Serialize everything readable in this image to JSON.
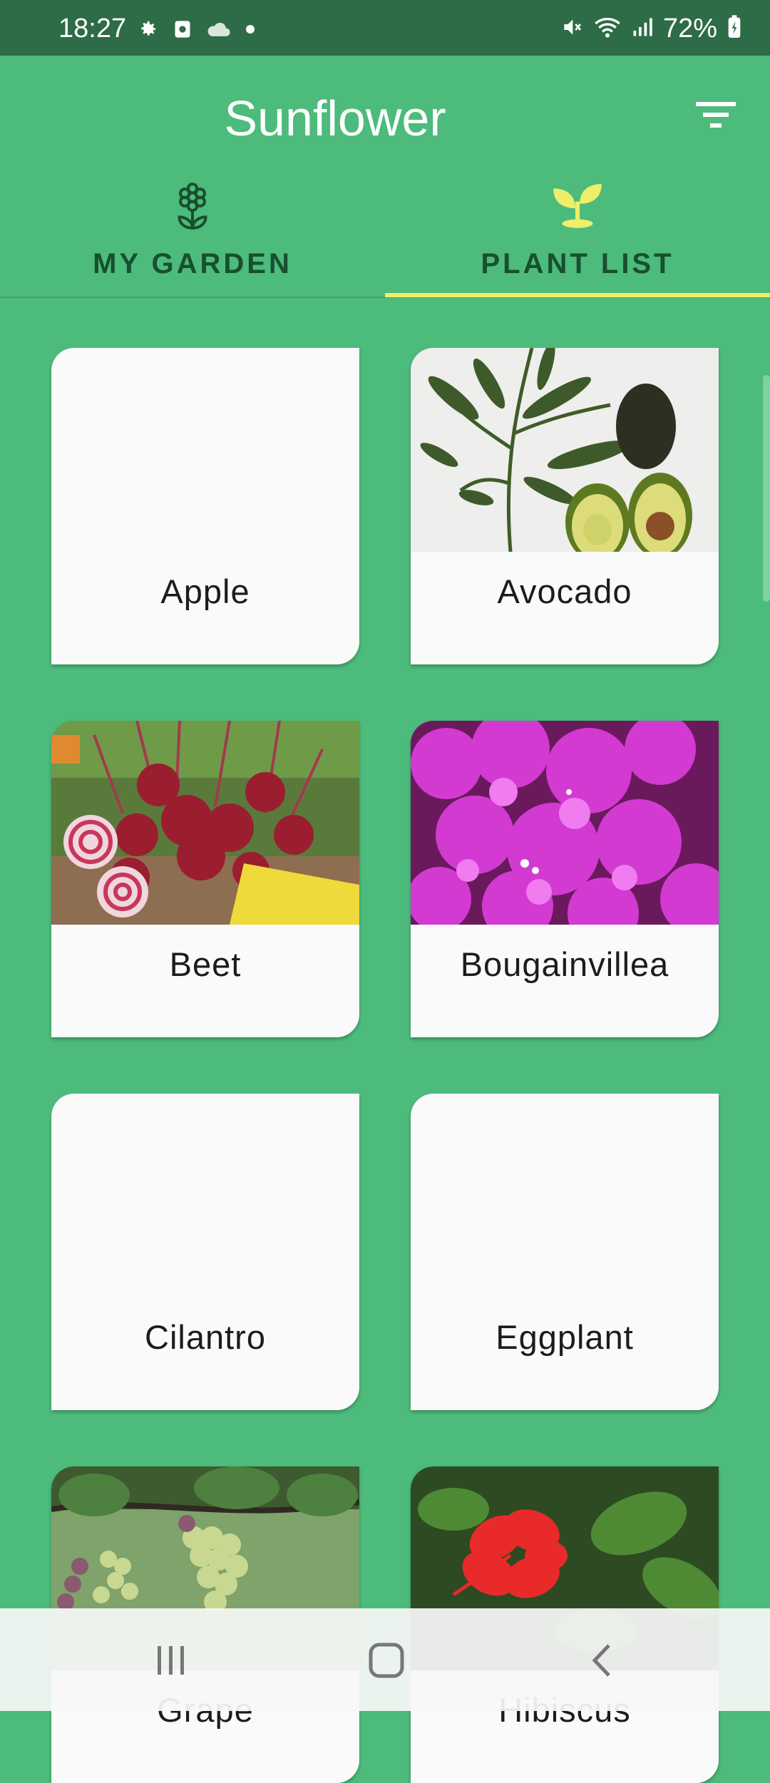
{
  "status_bar": {
    "time": "18:27",
    "battery": "72%",
    "left_icons": [
      "settings-icon",
      "screen-record-icon",
      "cloud-icon",
      "dot-icon"
    ],
    "right_icons": [
      "mute-icon",
      "wifi-icon",
      "signal-icon",
      "battery-icon"
    ]
  },
  "app_bar": {
    "title": "Sunflower",
    "filter_icon": "filter-list-icon"
  },
  "tabs": [
    {
      "label": "MY GARDEN",
      "icon": "flower-icon",
      "selected": false
    },
    {
      "label": "PLANT LIST",
      "icon": "sprout-icon",
      "selected": true
    }
  ],
  "colors": {
    "primary": "#4cbb7b",
    "status_bar": "#2e6b47",
    "tab_indicator": "#efee6a",
    "tab_text": "#184f2e",
    "card": "#fafafa"
  },
  "plants": [
    {
      "name": "Apple",
      "has_image": false
    },
    {
      "name": "Avocado",
      "has_image": true
    },
    {
      "name": "Beet",
      "has_image": true
    },
    {
      "name": "Bougainvillea",
      "has_image": true
    },
    {
      "name": "Cilantro",
      "has_image": false
    },
    {
      "name": "Eggplant",
      "has_image": false
    },
    {
      "name": "Grape",
      "has_image": true
    },
    {
      "name": "Hibiscus",
      "has_image": true
    }
  ],
  "nav_bar": {
    "buttons": [
      "recent-apps-icon",
      "home-icon",
      "back-icon"
    ]
  }
}
